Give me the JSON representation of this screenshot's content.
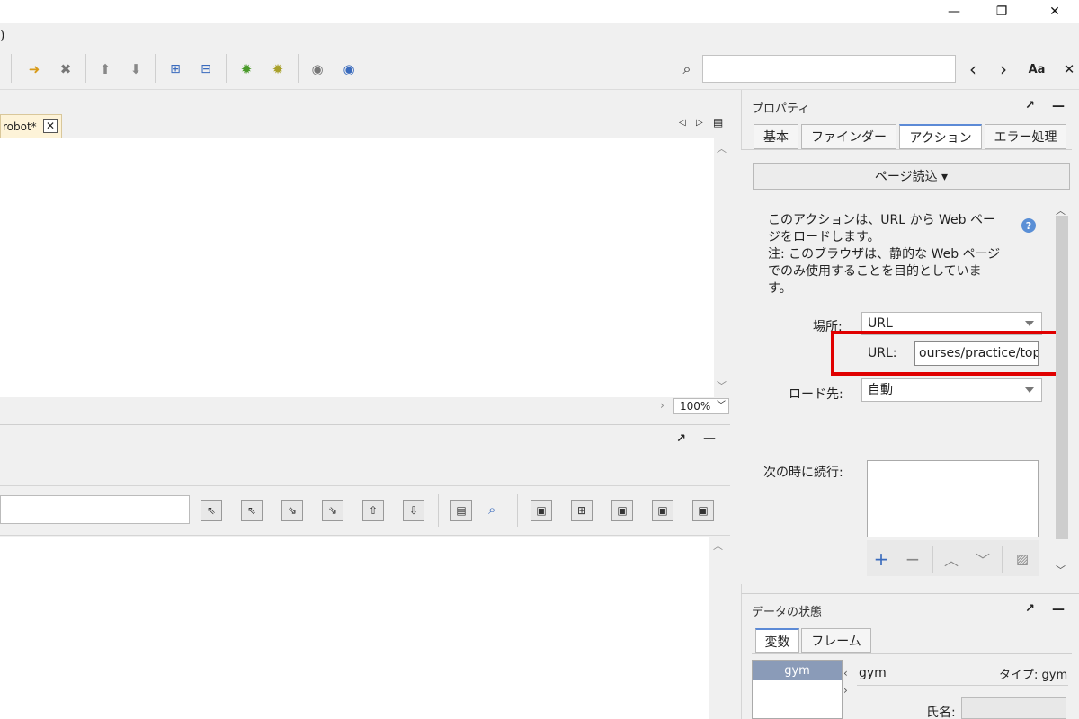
{
  "menu": {
    "fragment": ")"
  },
  "window": {
    "minimize": "—",
    "restore": "❐",
    "close": "✕"
  },
  "toolbar": {
    "search_placeholder": "",
    "prev": "‹",
    "next": "›",
    "match_case": "Aa",
    "close": "✕"
  },
  "editor": {
    "tab_label": "robot*",
    "tab_close": "✕",
    "zoom": "100%"
  },
  "properties": {
    "title": "プロパティ",
    "tabs": [
      "基本",
      "ファインダー",
      "アクション",
      "エラー処理"
    ],
    "active_tab": "アクション",
    "action_button": "ページ読込 ▾",
    "description": "このアクションは、URL から Web ペー\nジをロードします。\n注: このブラウザは、静的な Web ページ\nでのみ使用することを目的としていま\nす。",
    "location_label": "場所:",
    "location_value": "URL",
    "url_label": "URL:",
    "url_value": "ourses/practice/top",
    "load_target_label": "ロード先:",
    "load_target_value": "自動",
    "continue_label": "次の時に続行:"
  },
  "data_state": {
    "title": "データの状態",
    "tabs": [
      "変数",
      "フレーム"
    ],
    "active_tab": "変数",
    "variable_selected": "gym",
    "variable_name": "gym",
    "type_label": "タイプ: gym",
    "name_label": "氏名:"
  },
  "colors": {
    "highlight": "#e00000",
    "selection": "#8a9bb8",
    "tab_accent": "#5c8ad6"
  }
}
